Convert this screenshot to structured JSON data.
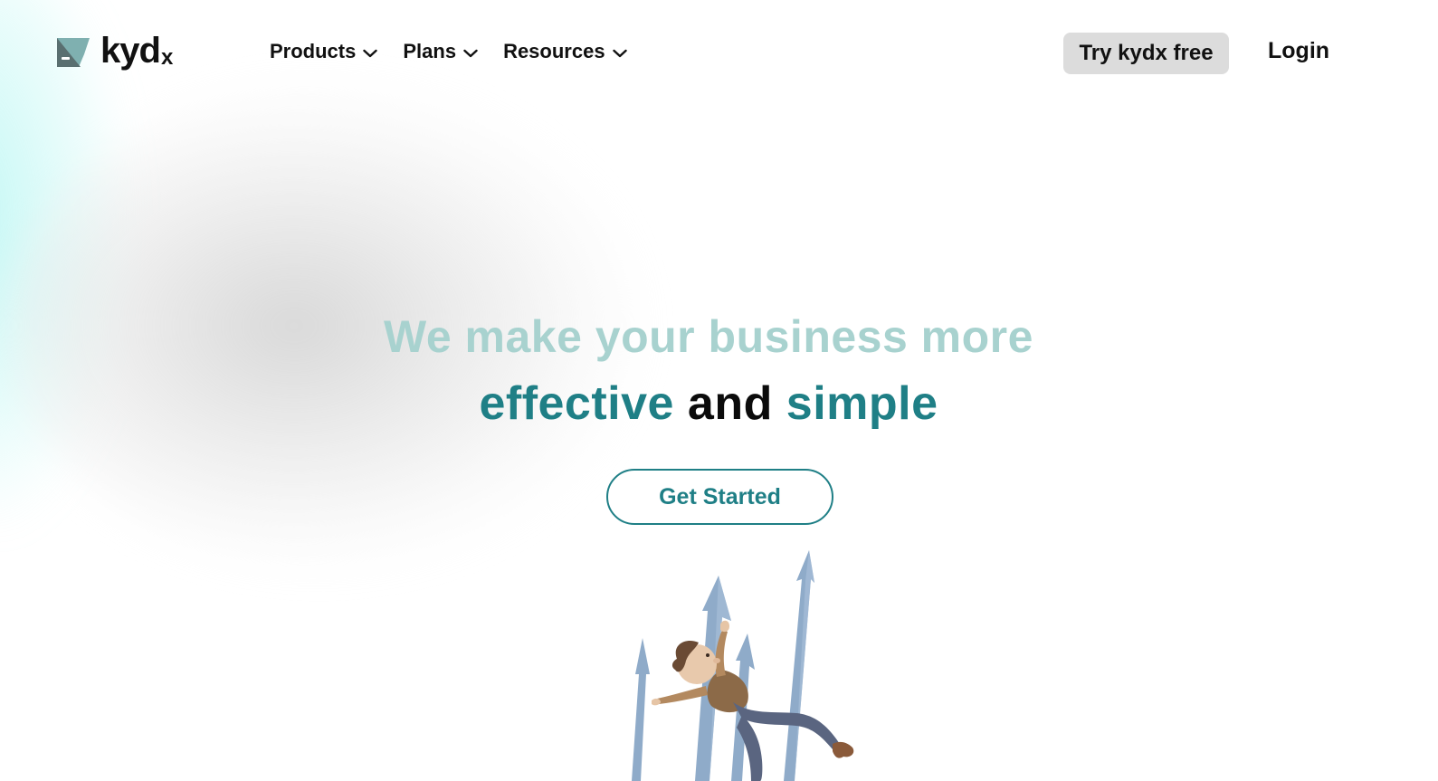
{
  "brand": {
    "name": "kyd",
    "suffix": "x",
    "icon": "kydx-logo-icon"
  },
  "nav": {
    "items": [
      {
        "label": "Products",
        "icon": "chevron-down-icon"
      },
      {
        "label": "Plans",
        "icon": "chevron-down-icon"
      },
      {
        "label": "Resources",
        "icon": "chevron-down-icon"
      }
    ]
  },
  "header": {
    "try_label": "Try kydx free",
    "login_label": "Login"
  },
  "hero": {
    "line1": "We make your business more",
    "line2_word1": "effective",
    "line2_word2": " and ",
    "line2_word3": "simple",
    "cta_label": "Get Started",
    "illustration": "person-climbing-arrows-illustration"
  },
  "colors": {
    "accent": "#1f7f86",
    "accent_light": "#a8d2cf",
    "button_grey": "#dcdcdc",
    "text": "#111111"
  }
}
